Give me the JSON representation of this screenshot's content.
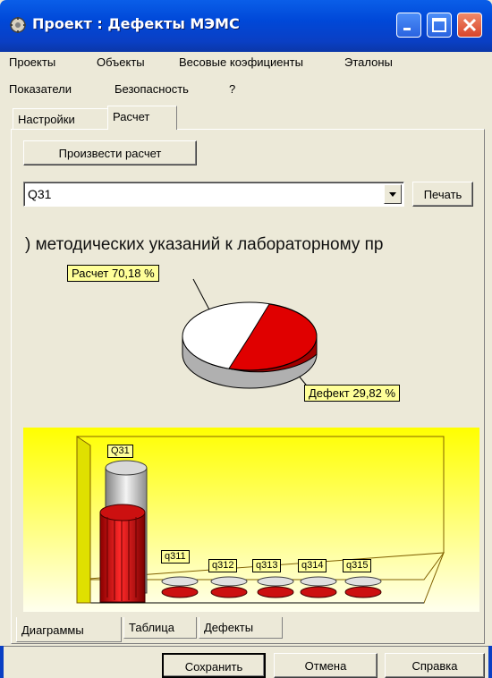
{
  "window": {
    "title": "Проект : Дефекты МЭМС"
  },
  "menu_row1": [
    "Проекты",
    "Объекты",
    "Весовые коэфициенты",
    "Эталоны"
  ],
  "menu_row2": [
    "Показатели",
    "Безопасность",
    "?"
  ],
  "top_tabs": [
    {
      "label": "Настройки",
      "active": false
    },
    {
      "label": "Расчет",
      "active": true
    }
  ],
  "toolbar": {
    "calculate_label": "Произвести расчет"
  },
  "selector": {
    "value": "Q31",
    "print_label": "Печать"
  },
  "chart_heading": ") методических указаний к лабораторному пр",
  "chart_data": [
    {
      "type": "pie",
      "labels": [
        "Расчет 70,18 %",
        "Дефект 29,82 %"
      ],
      "values": [
        70.18,
        29.82
      ],
      "colors": [
        "#ffffff",
        "#e00000"
      ]
    },
    {
      "type": "bar",
      "categories": [
        "Q31",
        "q311",
        "q312",
        "q313",
        "q314",
        "q315"
      ],
      "colors": {
        "bar": "#cc1010",
        "cylinder": "#c0c0c0",
        "background": "#ffff00"
      }
    }
  ],
  "bottom_tabs": [
    {
      "label": "Диаграммы",
      "active": true
    },
    {
      "label": "Таблица",
      "active": false
    },
    {
      "label": "Дефекты",
      "active": false
    }
  ],
  "footer": {
    "save_label": "Сохранить",
    "cancel_label": "Отмена",
    "help_label": "Справка"
  }
}
